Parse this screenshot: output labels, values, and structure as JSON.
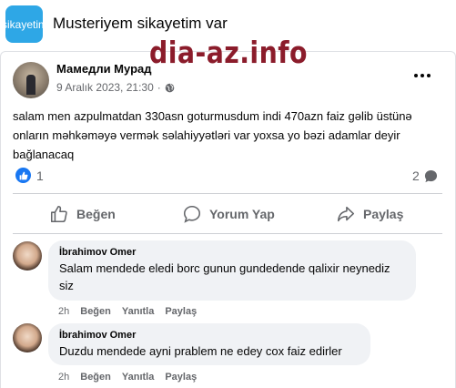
{
  "group": {
    "icon_text": "şikayetim v",
    "name": "Musteriyem sikayetim var"
  },
  "watermark": "dia-az.info",
  "post": {
    "author": "Мамедли Мурад",
    "date": "9 Aralık 2023, 21:30",
    "separator": "·",
    "text": "salam men azpulmatdan 330asn goturmusdum indi 470azn faiz gəlib üstünə onların məhkəməyə vermək səlahiyyətləri var yoxsa yo bəzi adamlar deyir bağlanacaq",
    "like_count": "1",
    "comment_count": "2"
  },
  "actions": {
    "like": "Beğen",
    "comment": "Yorum Yap",
    "share": "Paylaş"
  },
  "comments": [
    {
      "author": "İbrahimov Omer",
      "text": "Salam mendede eledi borc gunun gundedende qalixir neynediz siz",
      "time": "2h",
      "like": "Beğen",
      "reply": "Yanıtla",
      "share": "Paylaş"
    },
    {
      "author": "İbrahimov Omer",
      "text": "Duzdu mendede ayni prablem ne edey cox faiz edirler",
      "time": "2h",
      "like": "Beğen",
      "reply": "Yanıtla",
      "share": "Paylaş"
    }
  ],
  "colors": {
    "accent": "#1877f2",
    "watermark": "#8b1c2b",
    "secondary_text": "#65676b",
    "comment_bubble": "#f0f2f5"
  }
}
